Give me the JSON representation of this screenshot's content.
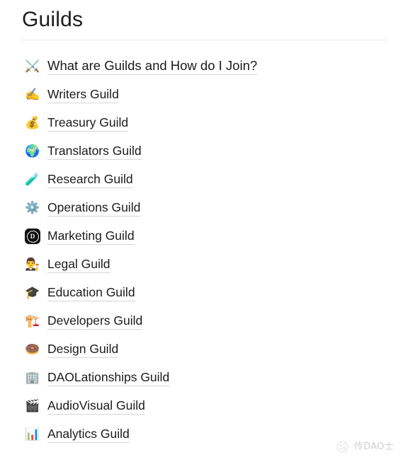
{
  "page": {
    "title": "Guilds",
    "background_color": "#ffffff",
    "text_color": "#1b1b1b",
    "divider_color": "#eceaea",
    "link_underline_color": "#d8d6d6"
  },
  "list": {
    "items": [
      {
        "icon": "crossed-swords-icon",
        "glyph": "⚔️",
        "label": "What are Guilds and How do I Join?"
      },
      {
        "icon": "writing-hand-icon",
        "glyph": "✍️",
        "label": "Writers Guild"
      },
      {
        "icon": "money-bag-icon",
        "glyph": "💰",
        "label": "Treasury Guild"
      },
      {
        "icon": "globe-icon",
        "glyph": "🌍",
        "label": "Translators Guild"
      },
      {
        "icon": "test-tube-icon",
        "glyph": "🧪",
        "label": "Research Guild"
      },
      {
        "icon": "gear-icon",
        "glyph": "⚙️",
        "label": "Operations Guild"
      },
      {
        "icon": "dark-badge-d-icon",
        "glyph": "D",
        "label": "Marketing Guild"
      },
      {
        "icon": "judge-person-icon",
        "glyph": "👨‍⚖️",
        "label": "Legal Guild"
      },
      {
        "icon": "graduation-cap-icon",
        "glyph": "🎓",
        "label": "Education Guild"
      },
      {
        "icon": "construction-crane-icon",
        "glyph": "🏗️",
        "label": "Developers Guild"
      },
      {
        "icon": "donut-icon",
        "glyph": "🍩",
        "label": "Design Guild"
      },
      {
        "icon": "office-buildings-icon",
        "glyph": "🏢",
        "label": "DAOLationships Guild"
      },
      {
        "icon": "clapper-board-icon",
        "glyph": "🎬",
        "label": "AudioVisual Guild"
      },
      {
        "icon": "bar-chart-icon",
        "glyph": "📊",
        "label": "Analytics Guild"
      }
    ]
  },
  "watermark": {
    "text": "传DAO士",
    "logo": "circular-logo-icon"
  }
}
